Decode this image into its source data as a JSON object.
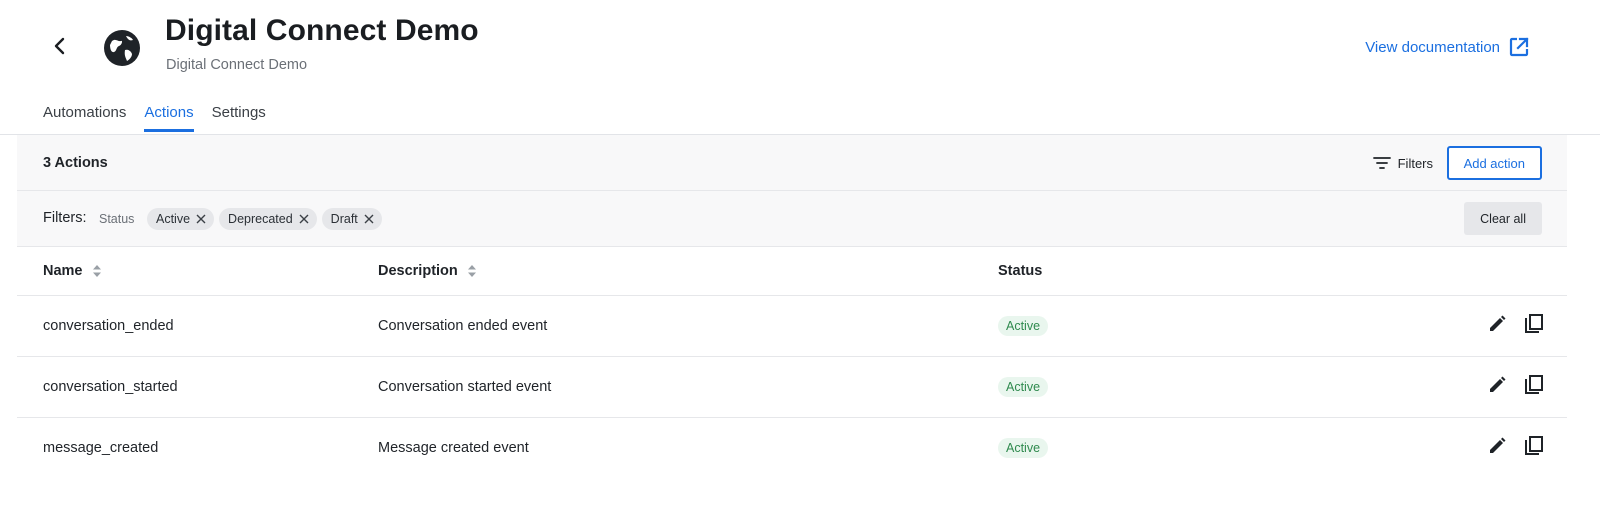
{
  "header": {
    "title": "Digital Connect Demo",
    "subtitle": "Digital Connect Demo",
    "docs_link": "View documentation"
  },
  "tabs": [
    {
      "label": "Automations",
      "active": false
    },
    {
      "label": "Actions",
      "active": true
    },
    {
      "label": "Settings",
      "active": false
    }
  ],
  "toolbar": {
    "count": "3 Actions",
    "filters_label": "Filters",
    "add_label": "Add action"
  },
  "filters": {
    "label": "Filters:",
    "key": "Status",
    "chips": [
      "Active",
      "Deprecated",
      "Draft"
    ],
    "clear_label": "Clear all"
  },
  "table": {
    "headers": {
      "name": "Name",
      "description": "Description",
      "status": "Status"
    },
    "rows": [
      {
        "name": "conversation_ended",
        "description": "Conversation ended event",
        "status": "Active"
      },
      {
        "name": "conversation_started",
        "description": "Conversation started event",
        "status": "Active"
      },
      {
        "name": "message_created",
        "description": "Message created event",
        "status": "Active"
      }
    ]
  },
  "colors": {
    "accent": "#1b6fe0",
    "status_active_bg": "#e9f6ee",
    "status_active_text": "#2f8a4e"
  },
  "icons": [
    "back-arrow-icon",
    "globe-icon",
    "external-link-icon",
    "filter-icon",
    "close-icon",
    "sort-icon",
    "edit-icon",
    "copy-icon"
  ]
}
